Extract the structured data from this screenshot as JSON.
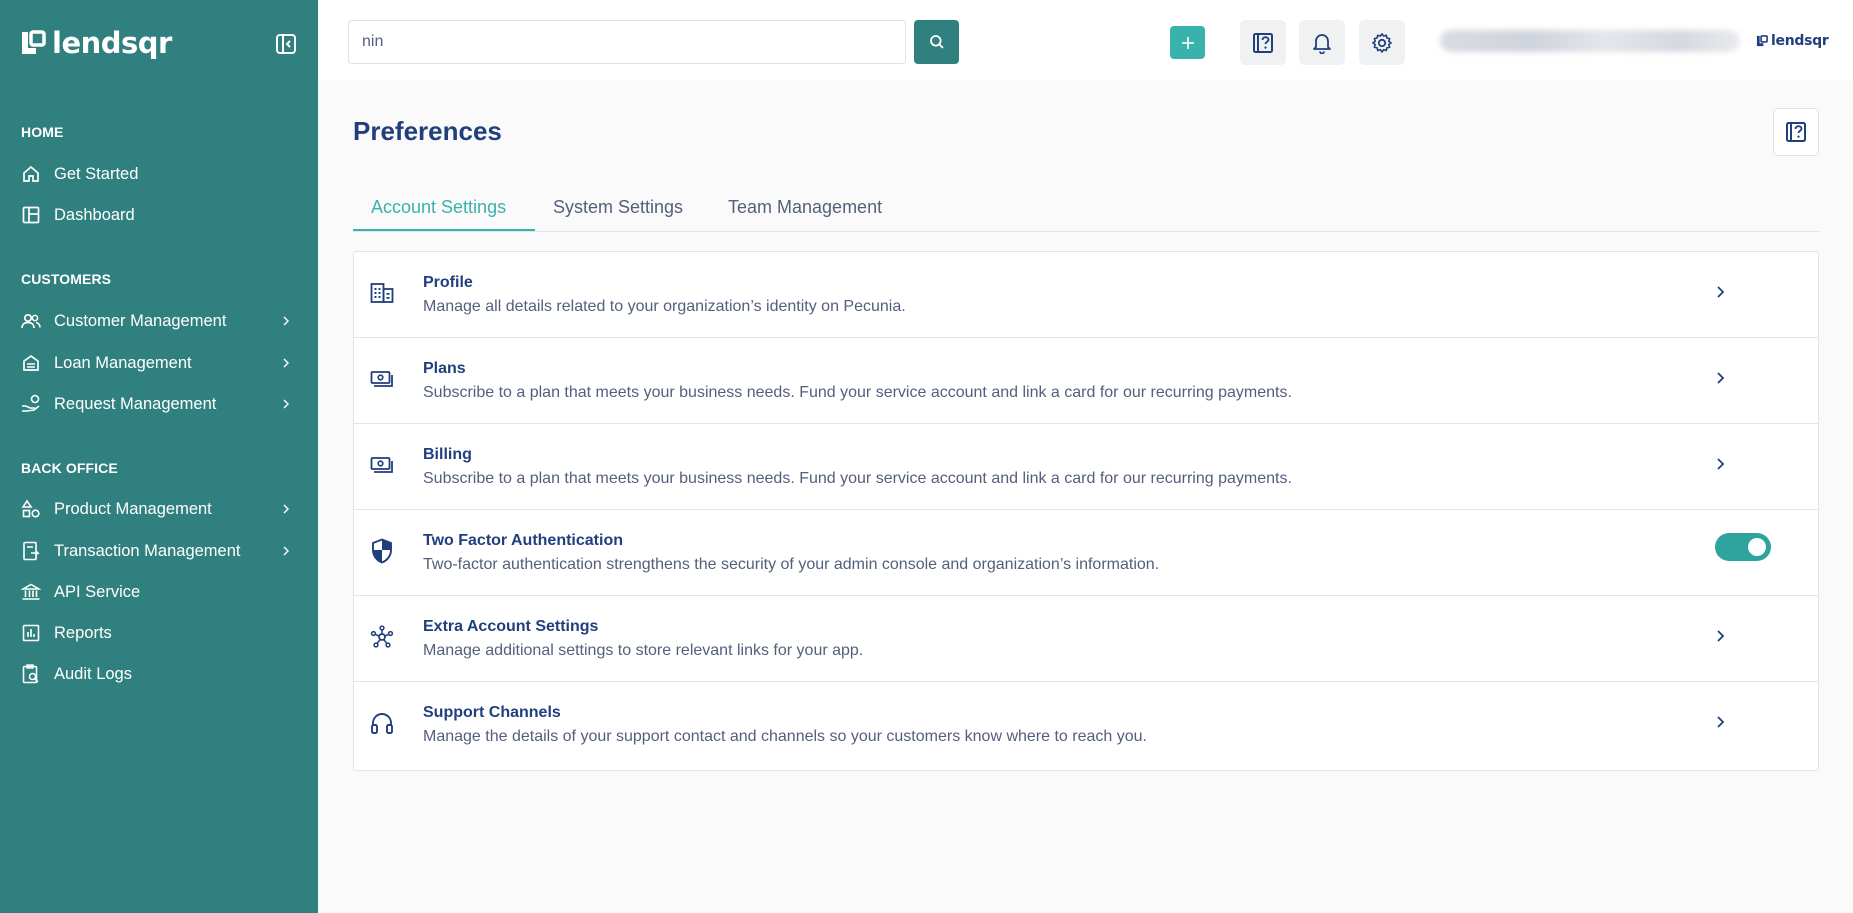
{
  "brand": {
    "name": "lendsqr",
    "small_name": "lendsqr"
  },
  "colors": {
    "sidebar": "#2f807f",
    "accent": "#39b2ad",
    "primary_text": "#213f7d",
    "secondary_text": "#545f7d"
  },
  "sidebar": {
    "sections": [
      {
        "label": "HOME"
      },
      {
        "label": "CUSTOMERS"
      },
      {
        "label": "BACK OFFICE"
      }
    ],
    "items": [
      {
        "label": "Get Started",
        "icon": "home-icon"
      },
      {
        "label": "Dashboard",
        "icon": "dashboard-icon"
      },
      {
        "label": "Customer Management",
        "icon": "users-icon"
      },
      {
        "label": "Loan Management",
        "icon": "loan-icon"
      },
      {
        "label": "Request Management",
        "icon": "request-icon"
      },
      {
        "label": "Product Management",
        "icon": "product-icon"
      },
      {
        "label": "Transaction Management",
        "icon": "transaction-icon"
      },
      {
        "label": "API Service",
        "icon": "bank-icon"
      },
      {
        "label": "Reports",
        "icon": "reports-icon"
      },
      {
        "label": "Audit Logs",
        "icon": "audit-icon"
      }
    ]
  },
  "header": {
    "search_value": "nin",
    "search_icon": "search-icon",
    "add_icon": "plus-icon",
    "help_icon": "help-icon",
    "notification_icon": "bell-icon",
    "settings_icon": "gear-icon"
  },
  "main": {
    "title": "Preferences",
    "tabs": [
      {
        "label": "Account Settings",
        "active": true
      },
      {
        "label": "System Settings",
        "active": false
      },
      {
        "label": "Team Management",
        "active": false
      }
    ],
    "rows": [
      {
        "title": "Profile",
        "description": "Manage all details related to your organization’s identity on Pecunia.",
        "icon": "building-icon",
        "control": "chevron"
      },
      {
        "title": "Plans",
        "description": "Subscribe to a plan that meets your business needs. Fund your service account and link a card for our recurring payments.",
        "icon": "money-icon",
        "control": "chevron"
      },
      {
        "title": "Billing",
        "description": "Subscribe to a plan that meets your business needs. Fund your service account and link a card for our recurring payments.",
        "icon": "money-icon",
        "control": "chevron"
      },
      {
        "title": "Two Factor Authentication",
        "description": "Two-factor authentication strengthens the security of your admin console and organization’s information.",
        "icon": "shield-icon",
        "control": "toggle",
        "toggle_on": true
      },
      {
        "title": "Extra Account Settings",
        "description": "Manage additional settings to store relevant links for your app.",
        "icon": "network-icon",
        "control": "chevron"
      },
      {
        "title": "Support Channels",
        "description": "Manage the details of your support contact and channels so your customers know where to reach you.",
        "icon": "headset-icon",
        "control": "chevron"
      }
    ]
  }
}
